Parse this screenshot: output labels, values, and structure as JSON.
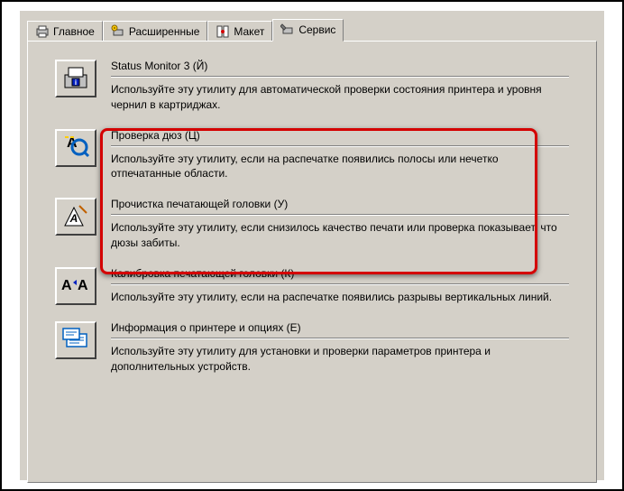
{
  "tabs": [
    {
      "label": "Главное"
    },
    {
      "label": "Расширенные"
    },
    {
      "label": "Макет"
    },
    {
      "label": "Сервис"
    }
  ],
  "utilities": [
    {
      "title": "Status Monitor 3 (Й)",
      "desc": "Используйте эту утилиту для автоматической проверки состояния принтера и уровня чернил в картриджах.",
      "icon": "status-monitor"
    },
    {
      "title": "Проверка дюз (Ц)",
      "desc": "Используйте эту утилиту, если на распечатке появились полосы или нечетко отпечатанные области.",
      "icon": "nozzle-check"
    },
    {
      "title": "Прочистка печатающей головки (У)",
      "desc": "Используйте эту утилиту, если снизилось качество печати или проверка показывает, что дюзы забиты.",
      "icon": "head-cleaning"
    },
    {
      "title": "Калибровка печатающей головки (К)",
      "desc": "Используйте эту утилиту, если на распечатке появились разрывы вертикальных линий.",
      "icon": "alignment"
    },
    {
      "title": "Информация о принтере и опциях (Е)",
      "desc": "Используйте эту утилиту для установки и проверки параметров принтера и дополнительных устройств.",
      "icon": "info"
    }
  ]
}
